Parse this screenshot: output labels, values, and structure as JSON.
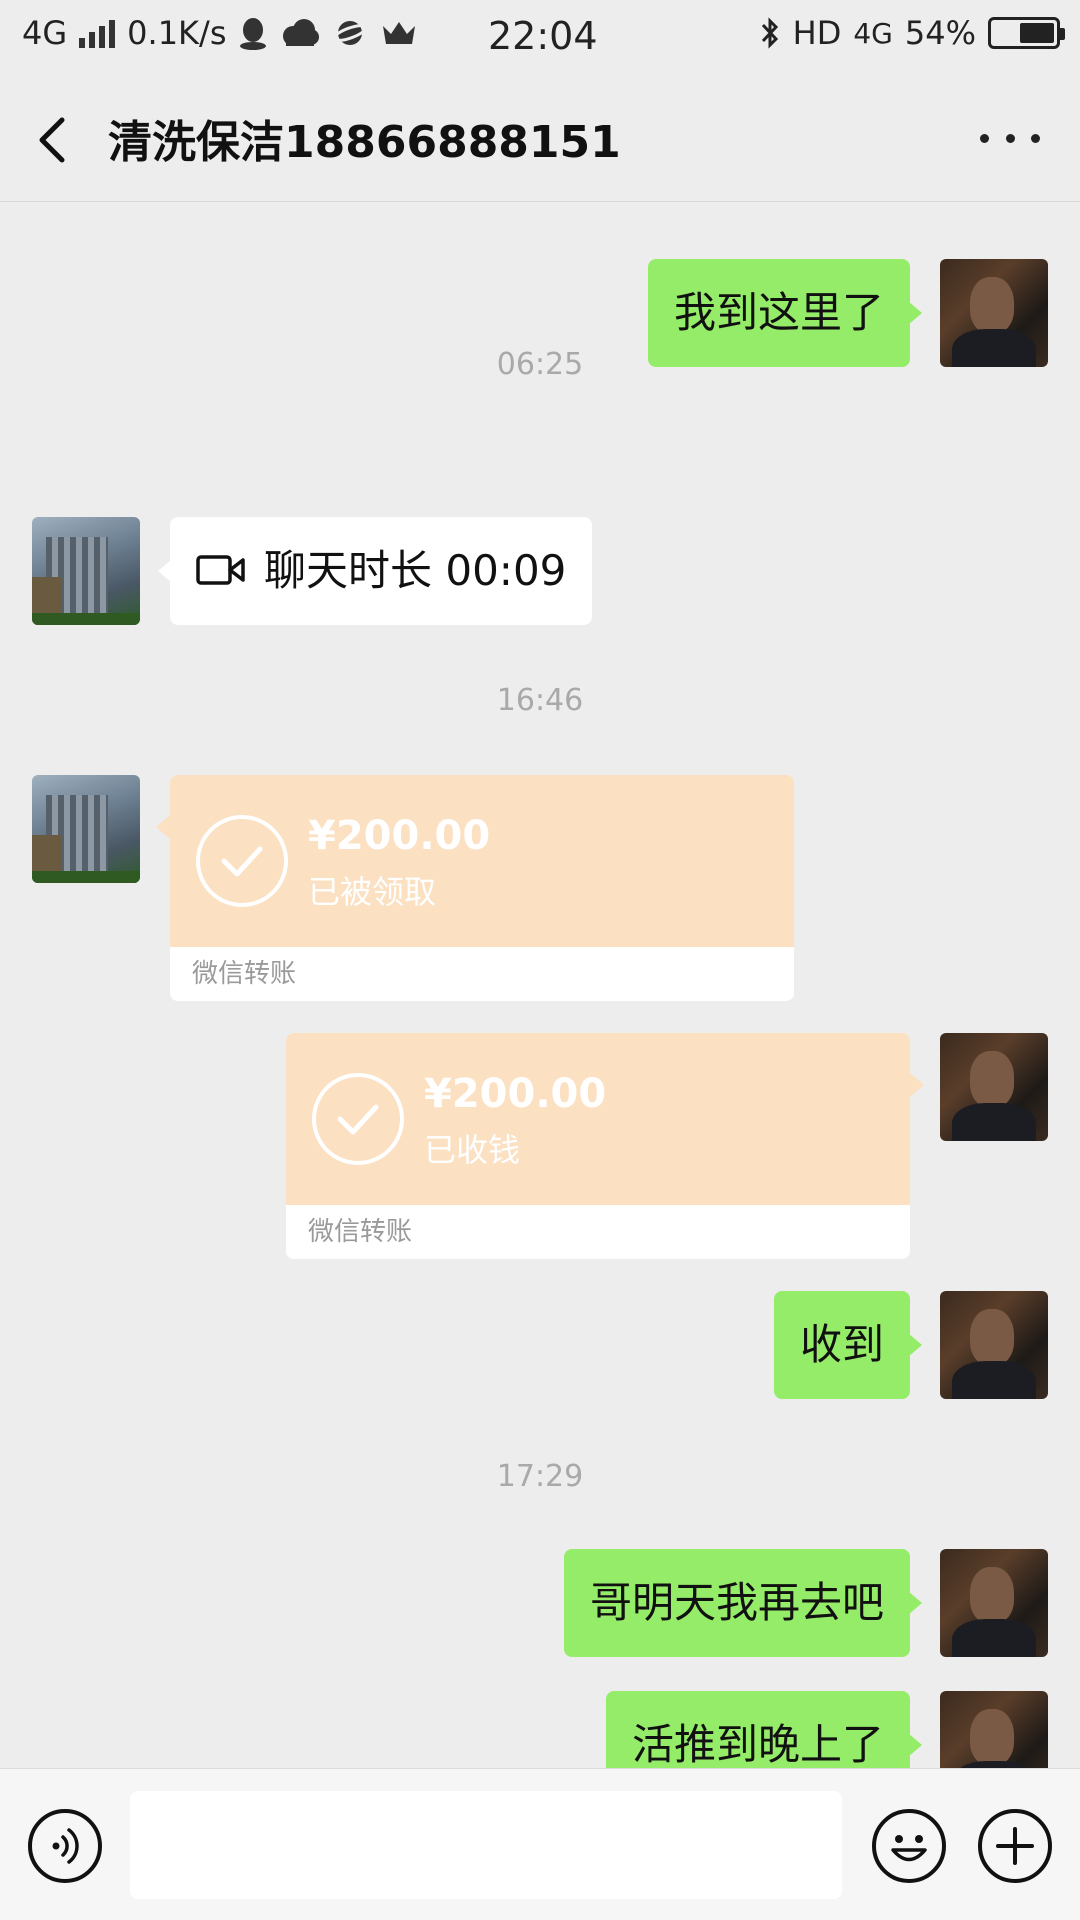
{
  "status_bar": {
    "network": "4G",
    "speed": "0.1K/s",
    "time": "22:04",
    "hd": "HD",
    "network_right": "4G",
    "battery": "54%"
  },
  "header": {
    "title": "清洗保洁18866888151"
  },
  "messages": {
    "m1": "我到这里了",
    "t1": "06:25",
    "call_text": "聊天时长 00:09",
    "t2": "16:46",
    "transfer1": {
      "amount": "¥200.00",
      "status": "已被领取",
      "label": "微信转账"
    },
    "transfer2": {
      "amount": "¥200.00",
      "status": "已收钱",
      "label": "微信转账"
    },
    "m2": "收到",
    "t3": "17:29",
    "m3": "哥明天我再去吧",
    "m4": "活推到晚上了"
  },
  "colors": {
    "my_bubble": "#95ec69",
    "their_bubble": "#ffffff",
    "transfer_card": "#fbe0c2",
    "background": "#ededed"
  }
}
